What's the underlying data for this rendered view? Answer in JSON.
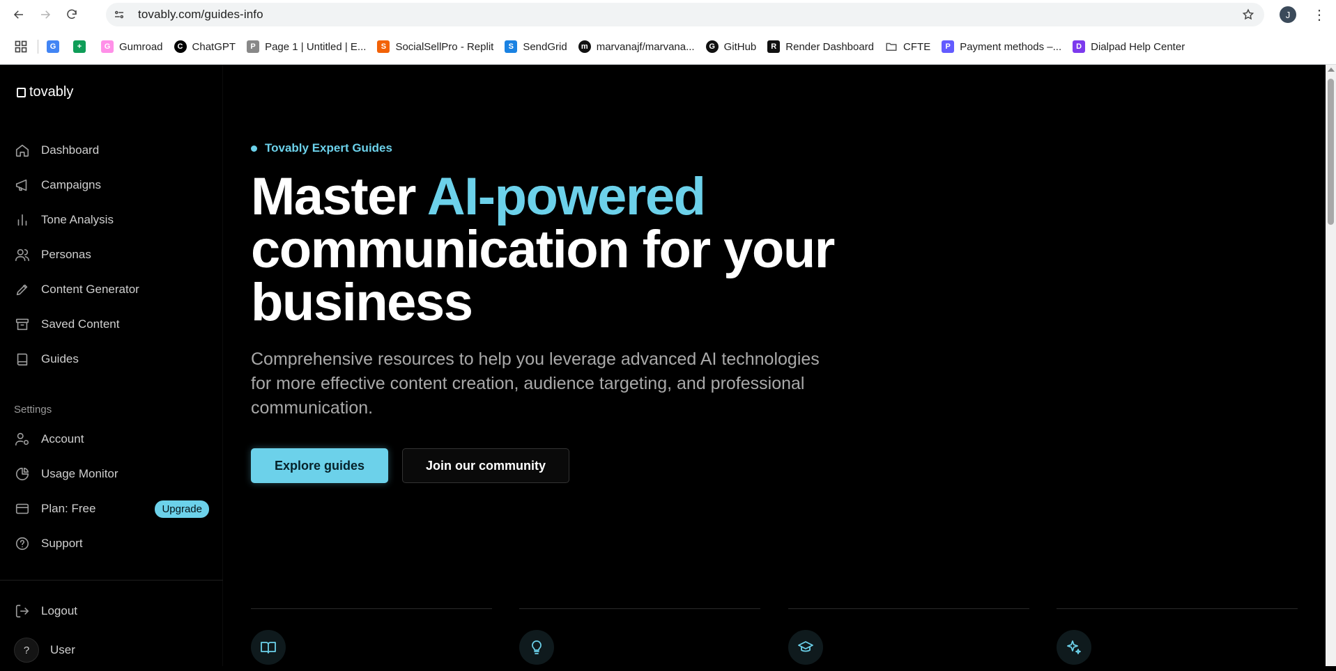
{
  "browser": {
    "url": "tovably.com/guides-info",
    "profile_initial": "J",
    "bookmarks": [
      {
        "label": "",
        "icon": "google-icon",
        "color": "#4285f4"
      },
      {
        "label": "",
        "icon": "sheets-icon",
        "color": "#0f9d58"
      },
      {
        "label": "Gumroad",
        "icon": "gumroad-icon",
        "color": "#ff90e8"
      },
      {
        "label": "ChatGPT",
        "icon": "chatgpt-icon",
        "color": "#000000"
      },
      {
        "label": "Page 1 | Untitled | E...",
        "icon": "page-icon",
        "color": "#888888"
      },
      {
        "label": "SocialSellPro - Replit",
        "icon": "replit-icon",
        "color": "#f26207"
      },
      {
        "label": "SendGrid",
        "icon": "sendgrid-icon",
        "color": "#1a82e2"
      },
      {
        "label": "marvanajf/marvana...",
        "icon": "github-icon",
        "color": "#111111"
      },
      {
        "label": "GitHub",
        "icon": "github-icon",
        "color": "#111111"
      },
      {
        "label": "Render Dashboard",
        "icon": "render-icon",
        "color": "#111111"
      },
      {
        "label": "CFTE",
        "icon": "folder-icon",
        "color": "#555555"
      },
      {
        "label": "Payment methods –...",
        "icon": "stripe-icon",
        "color": "#635bff"
      },
      {
        "label": "Dialpad Help Center",
        "icon": "dialpad-icon",
        "color": "#7c3aed"
      }
    ]
  },
  "app": {
    "logo": "tovably",
    "nav": [
      {
        "label": "Dashboard",
        "icon": "home-icon"
      },
      {
        "label": "Campaigns",
        "icon": "megaphone-icon"
      },
      {
        "label": "Tone Analysis",
        "icon": "bar-chart-icon"
      },
      {
        "label": "Personas",
        "icon": "users-icon"
      },
      {
        "label": "Content Generator",
        "icon": "pen-icon"
      },
      {
        "label": "Saved Content",
        "icon": "archive-icon"
      },
      {
        "label": "Guides",
        "icon": "book-icon"
      }
    ],
    "settings_label": "Settings",
    "settings_nav": [
      {
        "label": "Account",
        "icon": "user-cog-icon"
      },
      {
        "label": "Usage Monitor",
        "icon": "pie-chart-icon"
      },
      {
        "label": "Plan: Free",
        "icon": "credit-card-icon",
        "badge": "Upgrade"
      },
      {
        "label": "Support",
        "icon": "help-circle-icon"
      }
    ],
    "logout_label": "Logout",
    "user": {
      "avatar": "?",
      "name": "User"
    },
    "accent": "#6cd1ea"
  },
  "hero": {
    "eyebrow": "Tovably Expert Guides",
    "title_part1": "Master ",
    "title_accent": "AI-powered",
    "title_part2": "communication for your business",
    "subtitle": "Comprehensive resources to help you leverage advanced AI technologies for more effective content creation, audience targeting, and professional communication.",
    "primary_button": "Explore guides",
    "secondary_button": "Join our community"
  },
  "cards": [
    {
      "icon": "book-open-icon"
    },
    {
      "icon": "lightbulb-icon"
    },
    {
      "icon": "graduation-cap-icon"
    },
    {
      "icon": "sparkles-icon"
    }
  ]
}
